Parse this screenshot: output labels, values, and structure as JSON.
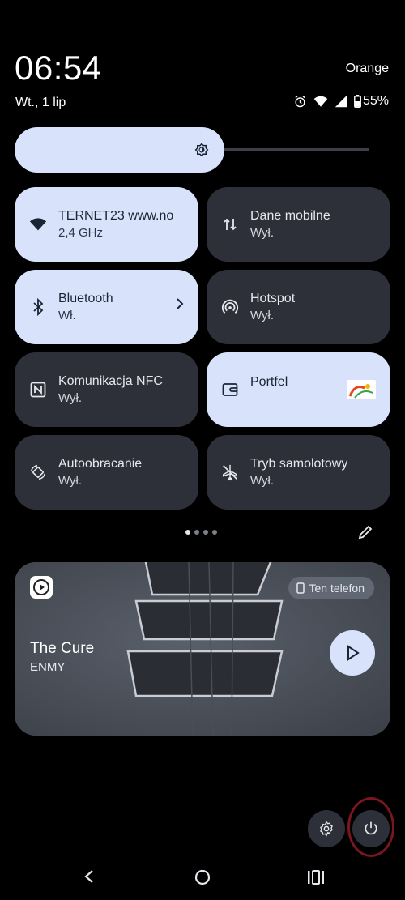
{
  "status": {
    "time": "06:54",
    "date": "Wt., 1 lip",
    "carrier": "Orange",
    "battery": "55%",
    "icons": [
      "alarm-icon",
      "wifi-icon",
      "signal-icon",
      "battery-icon"
    ]
  },
  "brightness": {
    "level": 0.55
  },
  "tiles": [
    {
      "label": "TERNET23 www.no",
      "status": "2,4 GHz",
      "icon": "wifi-icon",
      "on": true
    },
    {
      "label": "Dane mobilne",
      "status": "Wył.",
      "icon": "mobile-data-icon",
      "on": false
    },
    {
      "label": "Bluetooth",
      "status": "Wł.",
      "icon": "bluetooth-icon",
      "on": true
    },
    {
      "label": "Hotspot",
      "status": "Wył.",
      "icon": "hotspot-icon",
      "on": false
    },
    {
      "label": "Komunikacja NFC",
      "status": "Wył.",
      "icon": "nfc-icon",
      "on": false
    },
    {
      "label": "Portfel",
      "status": "",
      "icon": "wallet-icon",
      "on": true
    },
    {
      "label": "Autoobracanie",
      "status": "Wył.",
      "icon": "auto-rotate-icon",
      "on": false
    },
    {
      "label": "Tryb samolotowy",
      "status": "Wył.",
      "icon": "airplane-icon",
      "on": false
    }
  ],
  "pager": {
    "pages": 4,
    "current": 1
  },
  "media": {
    "title": "The Cure",
    "artist": "ENMY",
    "output": "Ten telefon"
  },
  "colors": {
    "tile_on": "#d8e2fb",
    "tile_off": "#2d3038",
    "power_highlight": "#7a1620"
  }
}
